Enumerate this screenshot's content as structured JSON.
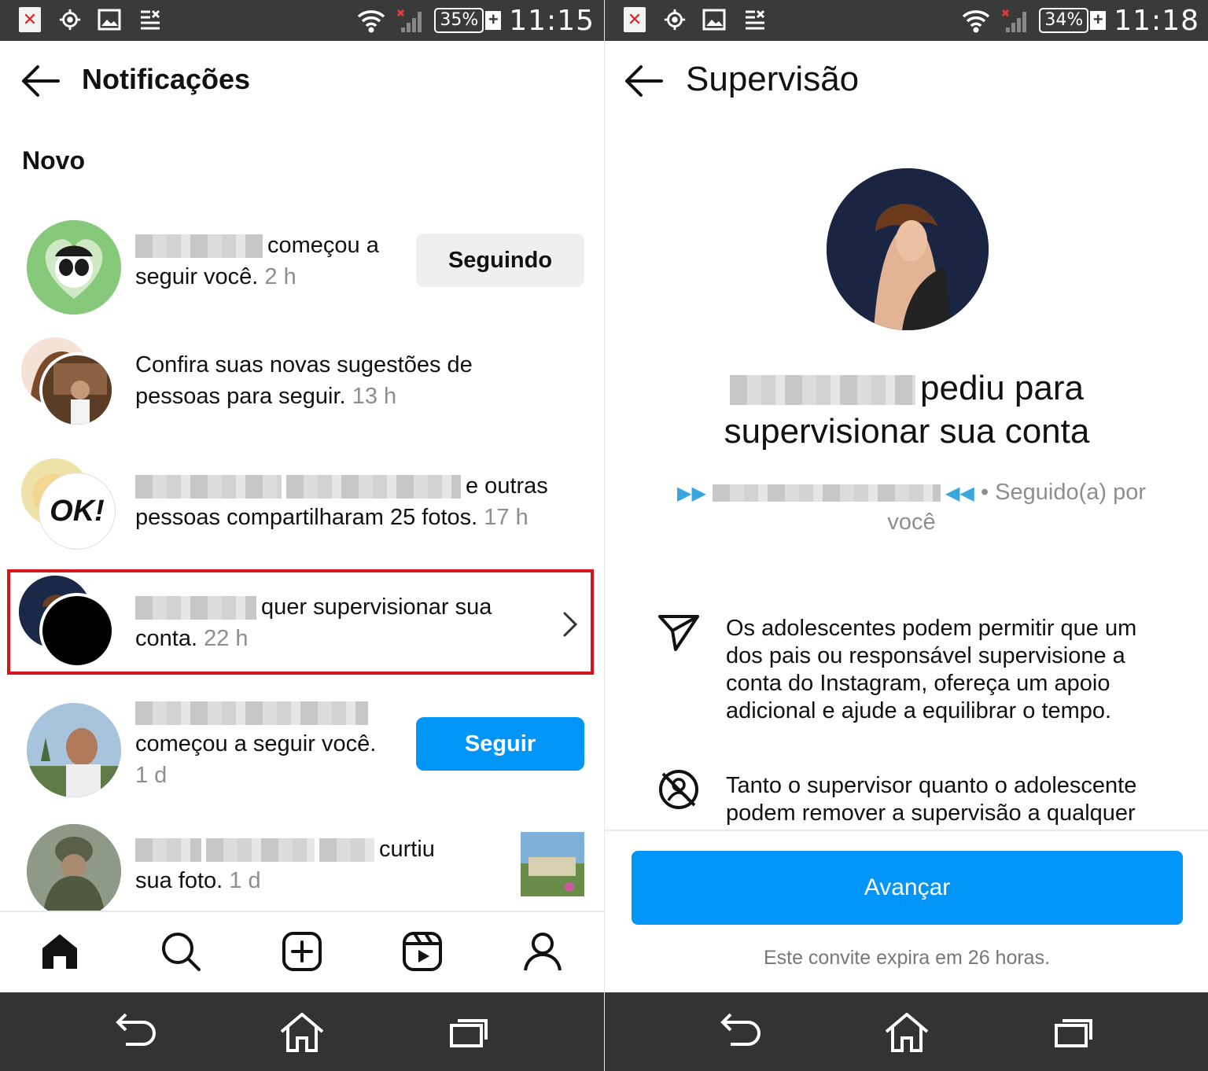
{
  "left": {
    "status": {
      "battery": "35%",
      "time": "11:15"
    },
    "header": {
      "title": "Notificações"
    },
    "section": "Novo",
    "notifications": [
      {
        "text": "começou a",
        "text2": "seguir você.",
        "time": "2 h",
        "action": "Seguindo"
      },
      {
        "text": "Confira suas novas sugestões de",
        "text2": "pessoas para seguir.",
        "time": "13 h"
      },
      {
        "text": "e outras",
        "text2": "pessoas compartilharam 25 fotos.",
        "time": "17 h",
        "badge": "OK!"
      },
      {
        "text": "quer supervisionar sua",
        "text2": "conta.",
        "time": "22 h"
      },
      {
        "text": "começou a seguir você.",
        "time": "1 d",
        "action": "Seguir"
      },
      {
        "text": "curtiu",
        "text2": "sua foto.",
        "time": "1 d"
      }
    ],
    "nav": [
      "home-icon",
      "search-icon",
      "create-icon",
      "reels-icon",
      "profile-icon"
    ]
  },
  "right": {
    "status": {
      "battery": "34%",
      "time": "11:18"
    },
    "header": {
      "title": "Supervisão"
    },
    "request_line1": "pediu para",
    "request_line2": "supervisionar sua conta",
    "meta": "• Seguido(a) por",
    "meta2": "você",
    "info1": "Os adolescentes podem permitir que um dos pais ou responsável supervisione a conta do Instagram, ofereça um apoio adicional e ajude a equilibrar o tempo.",
    "info2": "Tanto o supervisor quanto o adolescente podem remover a supervisão a qualquer",
    "button": "Avançar",
    "expire": "Este convite expira em 26 horas."
  },
  "colors": {
    "accent": "#0095f6",
    "highlight": "#d3151c",
    "statusbar": "#3a3a3a"
  }
}
